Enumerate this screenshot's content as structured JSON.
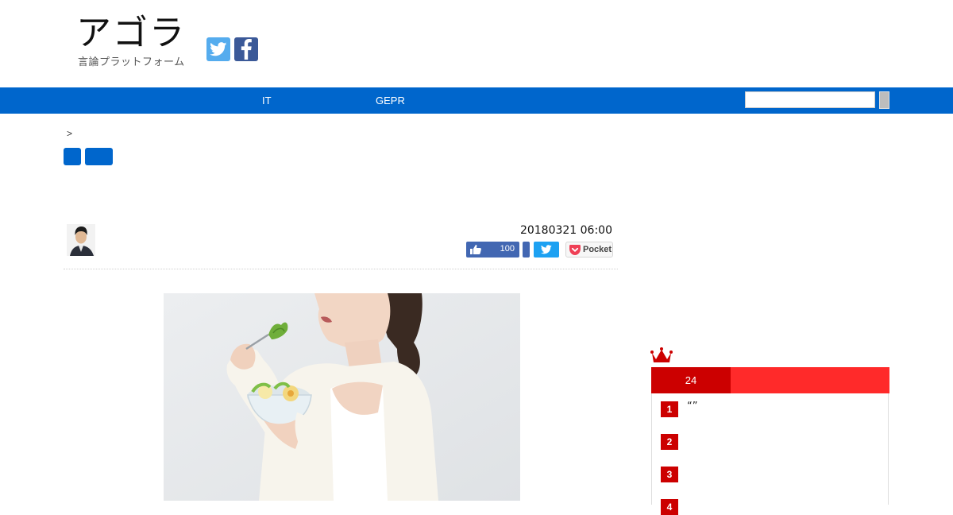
{
  "header": {
    "logo_main": "アゴラ",
    "logo_sub": "言論プラットフォーム",
    "social": [
      {
        "name": "twitter",
        "icon": "twitter-bird-icon",
        "color": "#55acee"
      },
      {
        "name": "facebook",
        "icon": "facebook-f-icon",
        "color": "#3b5998"
      }
    ]
  },
  "nav": {
    "bg_color": "#0066cc",
    "items": [
      {
        "label": "IT"
      },
      {
        "label": "GEPR"
      }
    ],
    "search": {
      "value": "",
      "placeholder": ""
    }
  },
  "breadcrumb": {
    "text": ">"
  },
  "article": {
    "date": "20180321 06:00",
    "share": {
      "like_count": "100",
      "pocket_label": "Pocket"
    }
  },
  "sidebar": {
    "ranking": {
      "tab_label": "24",
      "accent_color": "#ff2a2a",
      "items": [
        {
          "rank": "1",
          "title": "“”"
        },
        {
          "rank": "2",
          "title": ""
        },
        {
          "rank": "3",
          "title": ""
        },
        {
          "rank": "4",
          "title": ""
        }
      ]
    }
  }
}
